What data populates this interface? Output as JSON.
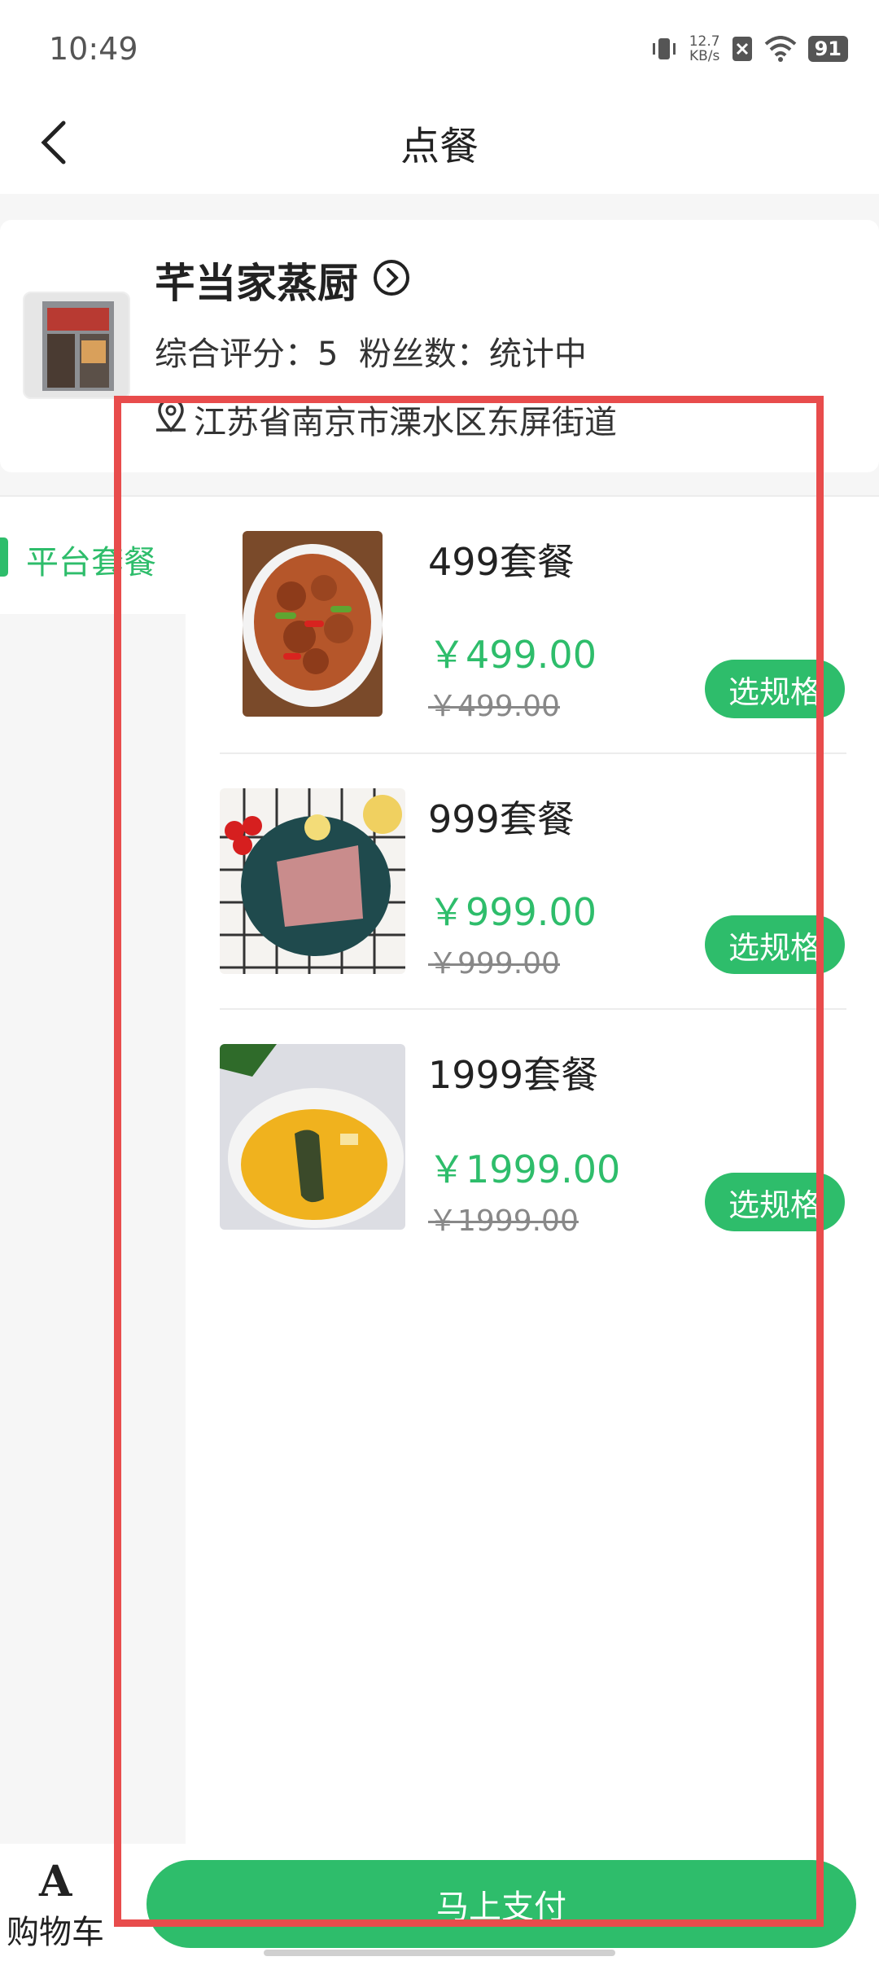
{
  "status_bar": {
    "time": "10:49",
    "net_speed_value": "12.7",
    "net_speed_unit": "KB/s",
    "battery": "91"
  },
  "header": {
    "title": "点餐",
    "back_icon": "chevron-left-icon"
  },
  "shop": {
    "name": "芊当家蒸厨",
    "rating_line": "综合评分：5  粉丝数：统计中",
    "address": "江苏省南京市溧水区东屏街道"
  },
  "sidebar": {
    "items": [
      {
        "label": "平台套餐",
        "active": true
      }
    ]
  },
  "items": [
    {
      "title": "499套餐",
      "price": "￥499.00",
      "original_price": "￥499.00",
      "button": "选规格"
    },
    {
      "title": "999套餐",
      "price": "￥999.00",
      "original_price": "￥999.00",
      "button": "选规格"
    },
    {
      "title": "1999套餐",
      "price": "￥1999.00",
      "original_price": "￥1999.00",
      "button": "选规格"
    }
  ],
  "bottom_bar": {
    "cart_label": "购物车",
    "pay_label": "马上支付"
  },
  "colors": {
    "accent": "#2ebd6b",
    "annotation": "#e84c4c"
  }
}
